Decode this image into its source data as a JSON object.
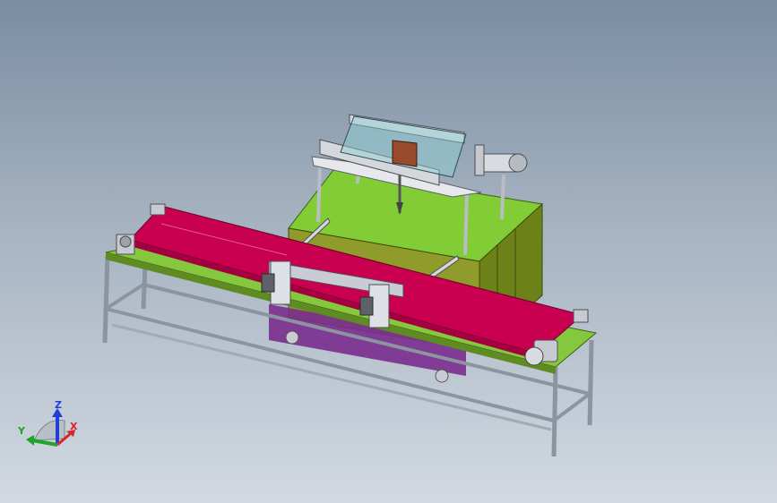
{
  "triad": {
    "z_label": "Z",
    "y_label": "Y",
    "x_label": "X",
    "z_color": "#1f3fd8",
    "y_color": "#1fa52a",
    "x_color": "#d9232d"
  },
  "colors": {
    "belt": "#c8004f",
    "table_top": "#7ec832",
    "cabinet_side": "#6f8a1c",
    "frame": "#8c94a0",
    "cabinet_accent": "#7a2c8e"
  }
}
